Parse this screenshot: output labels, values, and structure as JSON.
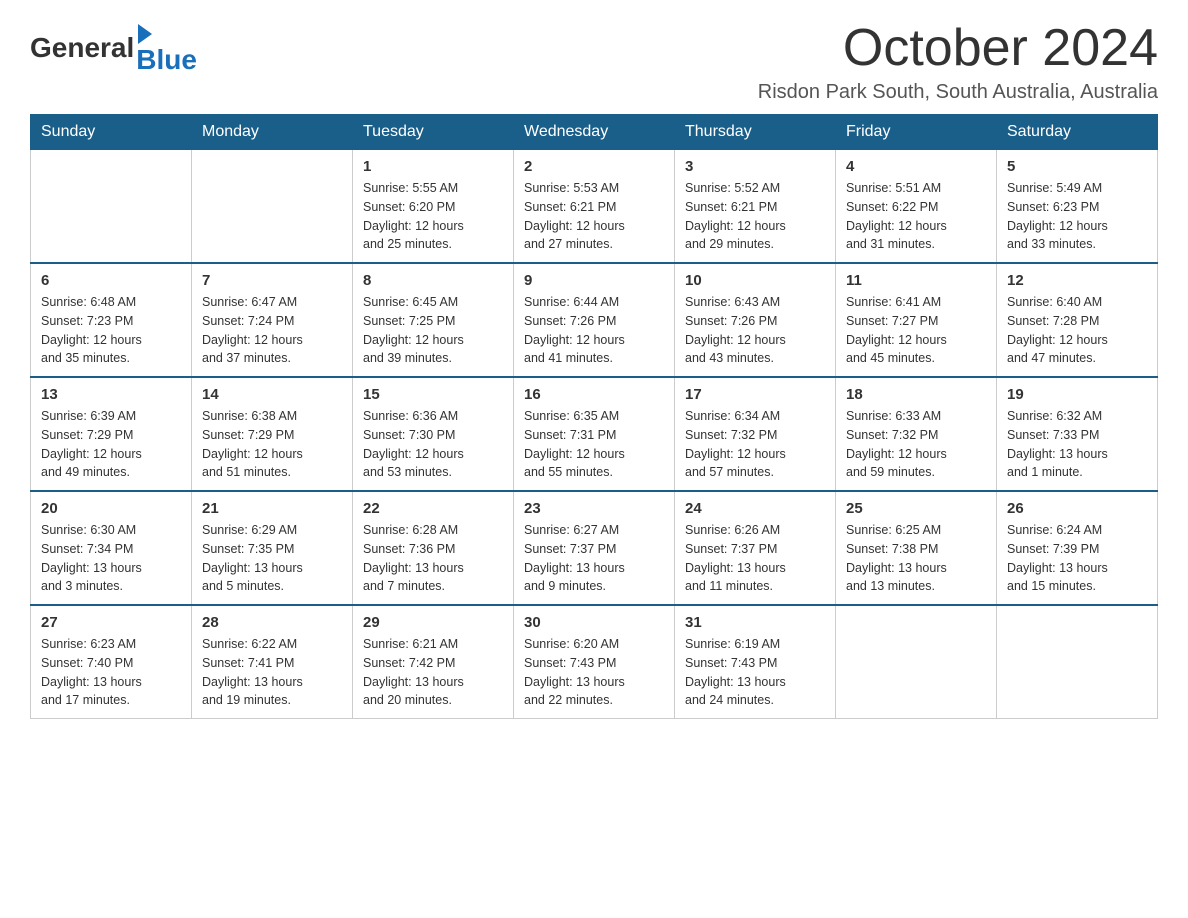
{
  "header": {
    "logo_general": "General",
    "logo_blue": "Blue",
    "month_title": "October 2024",
    "location": "Risdon Park South, South Australia, Australia"
  },
  "days_of_week": [
    "Sunday",
    "Monday",
    "Tuesday",
    "Wednesday",
    "Thursday",
    "Friday",
    "Saturday"
  ],
  "weeks": [
    [
      {
        "day": "",
        "info": ""
      },
      {
        "day": "",
        "info": ""
      },
      {
        "day": "1",
        "info": "Sunrise: 5:55 AM\nSunset: 6:20 PM\nDaylight: 12 hours\nand 25 minutes."
      },
      {
        "day": "2",
        "info": "Sunrise: 5:53 AM\nSunset: 6:21 PM\nDaylight: 12 hours\nand 27 minutes."
      },
      {
        "day": "3",
        "info": "Sunrise: 5:52 AM\nSunset: 6:21 PM\nDaylight: 12 hours\nand 29 minutes."
      },
      {
        "day": "4",
        "info": "Sunrise: 5:51 AM\nSunset: 6:22 PM\nDaylight: 12 hours\nand 31 minutes."
      },
      {
        "day": "5",
        "info": "Sunrise: 5:49 AM\nSunset: 6:23 PM\nDaylight: 12 hours\nand 33 minutes."
      }
    ],
    [
      {
        "day": "6",
        "info": "Sunrise: 6:48 AM\nSunset: 7:23 PM\nDaylight: 12 hours\nand 35 minutes."
      },
      {
        "day": "7",
        "info": "Sunrise: 6:47 AM\nSunset: 7:24 PM\nDaylight: 12 hours\nand 37 minutes."
      },
      {
        "day": "8",
        "info": "Sunrise: 6:45 AM\nSunset: 7:25 PM\nDaylight: 12 hours\nand 39 minutes."
      },
      {
        "day": "9",
        "info": "Sunrise: 6:44 AM\nSunset: 7:26 PM\nDaylight: 12 hours\nand 41 minutes."
      },
      {
        "day": "10",
        "info": "Sunrise: 6:43 AM\nSunset: 7:26 PM\nDaylight: 12 hours\nand 43 minutes."
      },
      {
        "day": "11",
        "info": "Sunrise: 6:41 AM\nSunset: 7:27 PM\nDaylight: 12 hours\nand 45 minutes."
      },
      {
        "day": "12",
        "info": "Sunrise: 6:40 AM\nSunset: 7:28 PM\nDaylight: 12 hours\nand 47 minutes."
      }
    ],
    [
      {
        "day": "13",
        "info": "Sunrise: 6:39 AM\nSunset: 7:29 PM\nDaylight: 12 hours\nand 49 minutes."
      },
      {
        "day": "14",
        "info": "Sunrise: 6:38 AM\nSunset: 7:29 PM\nDaylight: 12 hours\nand 51 minutes."
      },
      {
        "day": "15",
        "info": "Sunrise: 6:36 AM\nSunset: 7:30 PM\nDaylight: 12 hours\nand 53 minutes."
      },
      {
        "day": "16",
        "info": "Sunrise: 6:35 AM\nSunset: 7:31 PM\nDaylight: 12 hours\nand 55 minutes."
      },
      {
        "day": "17",
        "info": "Sunrise: 6:34 AM\nSunset: 7:32 PM\nDaylight: 12 hours\nand 57 minutes."
      },
      {
        "day": "18",
        "info": "Sunrise: 6:33 AM\nSunset: 7:32 PM\nDaylight: 12 hours\nand 59 minutes."
      },
      {
        "day": "19",
        "info": "Sunrise: 6:32 AM\nSunset: 7:33 PM\nDaylight: 13 hours\nand 1 minute."
      }
    ],
    [
      {
        "day": "20",
        "info": "Sunrise: 6:30 AM\nSunset: 7:34 PM\nDaylight: 13 hours\nand 3 minutes."
      },
      {
        "day": "21",
        "info": "Sunrise: 6:29 AM\nSunset: 7:35 PM\nDaylight: 13 hours\nand 5 minutes."
      },
      {
        "day": "22",
        "info": "Sunrise: 6:28 AM\nSunset: 7:36 PM\nDaylight: 13 hours\nand 7 minutes."
      },
      {
        "day": "23",
        "info": "Sunrise: 6:27 AM\nSunset: 7:37 PM\nDaylight: 13 hours\nand 9 minutes."
      },
      {
        "day": "24",
        "info": "Sunrise: 6:26 AM\nSunset: 7:37 PM\nDaylight: 13 hours\nand 11 minutes."
      },
      {
        "day": "25",
        "info": "Sunrise: 6:25 AM\nSunset: 7:38 PM\nDaylight: 13 hours\nand 13 minutes."
      },
      {
        "day": "26",
        "info": "Sunrise: 6:24 AM\nSunset: 7:39 PM\nDaylight: 13 hours\nand 15 minutes."
      }
    ],
    [
      {
        "day": "27",
        "info": "Sunrise: 6:23 AM\nSunset: 7:40 PM\nDaylight: 13 hours\nand 17 minutes."
      },
      {
        "day": "28",
        "info": "Sunrise: 6:22 AM\nSunset: 7:41 PM\nDaylight: 13 hours\nand 19 minutes."
      },
      {
        "day": "29",
        "info": "Sunrise: 6:21 AM\nSunset: 7:42 PM\nDaylight: 13 hours\nand 20 minutes."
      },
      {
        "day": "30",
        "info": "Sunrise: 6:20 AM\nSunset: 7:43 PM\nDaylight: 13 hours\nand 22 minutes."
      },
      {
        "day": "31",
        "info": "Sunrise: 6:19 AM\nSunset: 7:43 PM\nDaylight: 13 hours\nand 24 minutes."
      },
      {
        "day": "",
        "info": ""
      },
      {
        "day": "",
        "info": ""
      }
    ]
  ]
}
